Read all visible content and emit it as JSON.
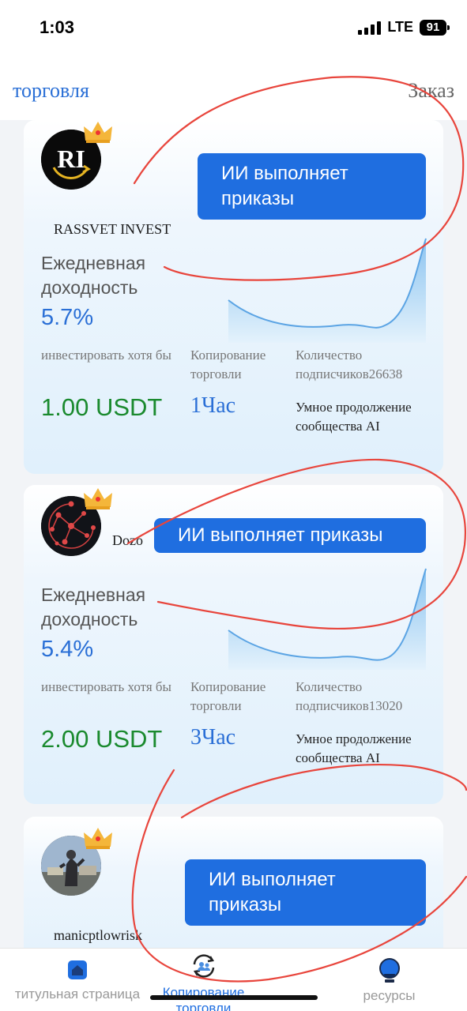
{
  "status": {
    "time": "1:03",
    "network": "LTE",
    "battery": "91"
  },
  "nav": {
    "left": "торговля",
    "right": "Заказ"
  },
  "labels": {
    "daily_yield": "Ежедневная доходность",
    "invest_min": "инвестировать хотя бы",
    "copy_trading": "Копирование торговли",
    "subscribers_prefix": "Количество подписчиков",
    "smart_community": "Умное продолжение сообщества AI"
  },
  "cards": [
    {
      "name": "RASSVET INVEST",
      "avatar_icon": "rassvet-logo",
      "button": "ИИ выполняет приказы",
      "yield": "5.7%",
      "min_invest": "1.00 USDT",
      "duration": "1Час",
      "subscribers": "Количество подписчиков26638"
    },
    {
      "name": "Dozo",
      "avatar_icon": "network-logo",
      "button": "ИИ выполняет приказы",
      "yield": "5.4%",
      "min_invest": "2.00 USDT",
      "duration": "3Час",
      "subscribers": "Количество подписчиков13020"
    },
    {
      "name": "manicptlowrisk",
      "avatar_icon": "photo-avatar",
      "button": "ИИ выполняет приказы"
    }
  ],
  "tabs": [
    {
      "label": "титульная страница",
      "icon": "home-icon"
    },
    {
      "label": "Копирование торговли",
      "icon": "copy-trade-icon",
      "active": true
    },
    {
      "label": "ресурсы",
      "icon": "resources-icon"
    }
  ],
  "colors": {
    "accent": "#1f6ee0",
    "green": "#1a8a2e",
    "ink": "#e8453c"
  }
}
